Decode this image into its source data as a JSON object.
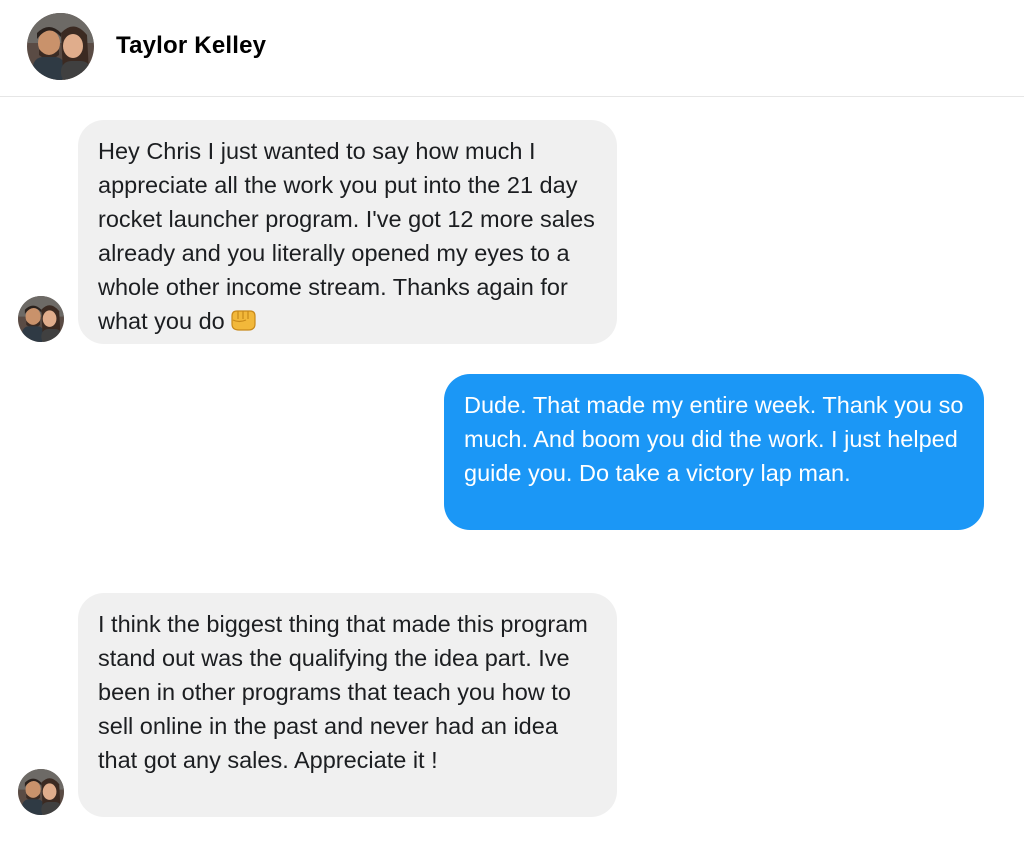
{
  "header": {
    "contact_name": "Taylor Kelley",
    "avatar_icon": "contact-avatar"
  },
  "messages": [
    {
      "direction": "incoming",
      "text": "Hey Chris I just wanted to say how much I appreciate all the work you put into the 21 day rocket launcher program. I've got 12 more sales already and you literally opened my eyes to a whole other income stream. Thanks again for what you do",
      "emoji": "oncoming-fist-emoji"
    },
    {
      "direction": "outgoing",
      "text": "Dude. That made my entire week. Thank you so much. And boom you did the work. I just helped guide you. Do take a victory lap man."
    },
    {
      "direction": "incoming",
      "text": "I think the biggest thing that made this program stand out was the qualifying the idea part. Ive been in other programs that teach you how to sell online in the past and never had an idea that got any sales. Appreciate it !"
    }
  ],
  "colors": {
    "incoming_bubble": "#f0f0f0",
    "outgoing_bubble": "#1b97f6",
    "outgoing_text": "#ffffff"
  }
}
